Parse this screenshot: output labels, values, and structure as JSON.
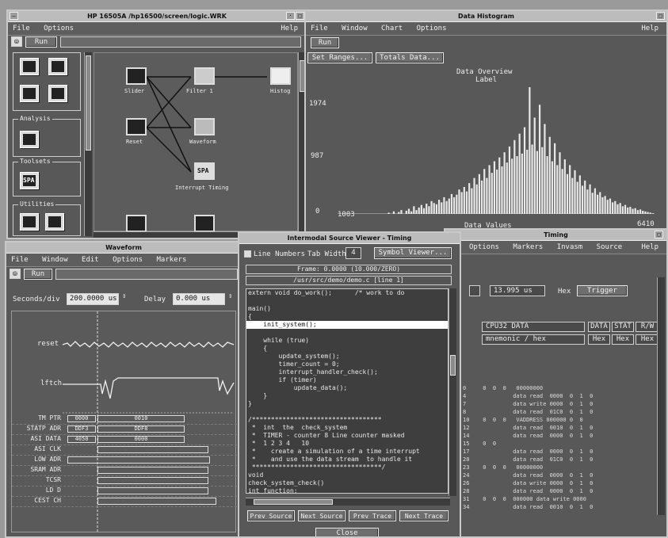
{
  "main_window": {
    "title": "HP 16505A   /hp16500/screen/logic.WRK",
    "menu": [
      "File",
      "Options"
    ],
    "help": "Help",
    "run_label": "Run",
    "groups": {
      "analysis_title": "Analysis",
      "toolsets_title": "Toolsets",
      "utilities_title": "Utilities"
    },
    "toolset_icon_label": "SPA",
    "nodes": {
      "n1": "Slider",
      "n2": "Filter 1",
      "n3": "Histog",
      "n4": "Reset",
      "n5": "Waveform",
      "n6": "Interrupt Timing",
      "spa": "SPA"
    }
  },
  "histogram_window": {
    "title": "Data Histogram",
    "menu": [
      "File",
      "Window",
      "Chart",
      "Options"
    ],
    "help": "Help",
    "run_label": "Run",
    "btn_ranges": "Set Ranges...",
    "btn_totals": "Totals Data...",
    "chart_title": "Data Overview",
    "chart_subtitle": "Label",
    "y_top": "1974",
    "y_mid": "987",
    "y_bottom": "0",
    "x_left": "1003",
    "x_right": "6410",
    "x_label": "Data Values",
    "bar_color": "#e8e8e8"
  },
  "chart_data": {
    "type": "bar",
    "title": "Data Overview",
    "subtitle": "Label",
    "xlabel": "Data Values",
    "ylabel": "",
    "x_range": [
      1003,
      6410
    ],
    "ylim": [
      0,
      1974
    ],
    "y_ticks": [
      "0",
      "987",
      "1974"
    ],
    "values": [
      0,
      0,
      0,
      0,
      0,
      0,
      0,
      0,
      0,
      0,
      0,
      0,
      0,
      0,
      0,
      0,
      0,
      0,
      0,
      0,
      20,
      0,
      40,
      0,
      30,
      60,
      0,
      50,
      80,
      40,
      120,
      60,
      100,
      140,
      90,
      160,
      120,
      200,
      170,
      150,
      220,
      180,
      260,
      200,
      240,
      310,
      260,
      300,
      380,
      340,
      420,
      350,
      480,
      400,
      560,
      460,
      620,
      520,
      700,
      560,
      760,
      640,
      820,
      690,
      880,
      740,
      960,
      800,
      1050,
      860,
      1150,
      900,
      1250,
      940,
      1350,
      1000,
      1974,
      1080,
      1500,
      980,
      1700,
      1040,
      1400,
      900,
      1200,
      820,
      1100,
      760,
      960,
      700,
      850,
      620,
      760,
      560,
      680,
      500,
      600,
      440,
      520,
      380,
      460,
      330,
      400,
      300,
      340,
      260,
      280,
      220,
      240,
      180,
      200,
      150,
      170,
      120,
      140,
      100,
      110,
      80,
      90,
      60,
      70,
      50,
      40,
      30,
      20,
      10
    ]
  },
  "waveform_window": {
    "title": "Waveform",
    "menu": [
      "File",
      "Window",
      "Edit",
      "Options",
      "Markers"
    ],
    "run_label": "Run",
    "seconds_label": "Seconds/div",
    "seconds_value": "200.0000 us",
    "delay_label": "Delay",
    "delay_value": "0.000 us",
    "rows": [
      "reset",
      "lftch",
      "TM PTR",
      "STATP ADR",
      "ASI DATA",
      "ASI CLK",
      "LOW ADR",
      "SRAM ADR",
      "TCSR",
      "LD D",
      "CEST CH"
    ],
    "cells": [
      "0000",
      "0010",
      "DDF3",
      "DDF8",
      "4050",
      "0000"
    ]
  },
  "source_window": {
    "title": "Intermodal Source Viewer - Timing",
    "cb_line_numbers": "Line Numbers",
    "tab_width_label": "Tab Width",
    "tab_width_value": "4",
    "btn_symbol": "Symbol Viewer...",
    "frame_label": "Frame: 0.0000 (10.000/ZERO)",
    "path_label": "/usr/src/demo/demo.c  [line 1]",
    "lines": [
      "extern void do_work();      /* work to do",
      "",
      "main()",
      "{",
      "    init_system();",
      "",
      "    while (true)",
      "    {",
      "        update_system();",
      "        timer_count = 0;",
      "        interrupt_handler_check();",
      "        if (timer)",
      "            update_data();",
      "    }",
      "}",
      "",
      "/**********************************",
      " *  int  the  check_system",
      " *  TIMER - counter 8 Line counter masked",
      " *  1 2 3 4   10",
      " *    create a simulation of a time interrupt",
      " *    and use the data stream  to handle it",
      " **********************************/",
      "void",
      "check_system_check()",
      "int function;"
    ],
    "highlight_index": 4,
    "buttons": [
      "Prev Source",
      "Next Source",
      "Prev Trace",
      "Next Trace"
    ],
    "close_label": "Close"
  },
  "listing_window": {
    "title": "Timing",
    "menu": [
      "Options",
      "Markers",
      "Invasm",
      "Source"
    ],
    "help": "Help",
    "field_value": "13.995 us",
    "field_unit": "Hex",
    "trigger_label": "Trigger",
    "header_a": "CPU32 DATA",
    "header_b": "mnemonic / hex",
    "header_cols": [
      "DATA",
      "STAT",
      "R/W"
    ],
    "header_cols2": [
      "Hex",
      "Hex",
      "Hex"
    ],
    "rows": [
      "0     0  0  0   00000000",
      "4              data read  0000  0  1  0",
      "7              data write 0000  0  1  0",
      "8              data read  01C0  0  1  0",
      "10    0  0  0   VADDRESS 000000 0  0",
      "12             data read  0010  0  1  0",
      "14             data read  0000  0  1  0",
      "15    0  0",
      "17             data read  0000  0  1  0",
      "20             data read  01C0  0  1  0",
      "23    0  0  0   00000000",
      "24             data read  0000  0  1  0",
      "26             data write 0000  0  1  0",
      "28             data read  0000  0  1  0",
      "31    0  0  0  000000 data write 0000",
      "34             data read  0010  0  1  0"
    ]
  }
}
